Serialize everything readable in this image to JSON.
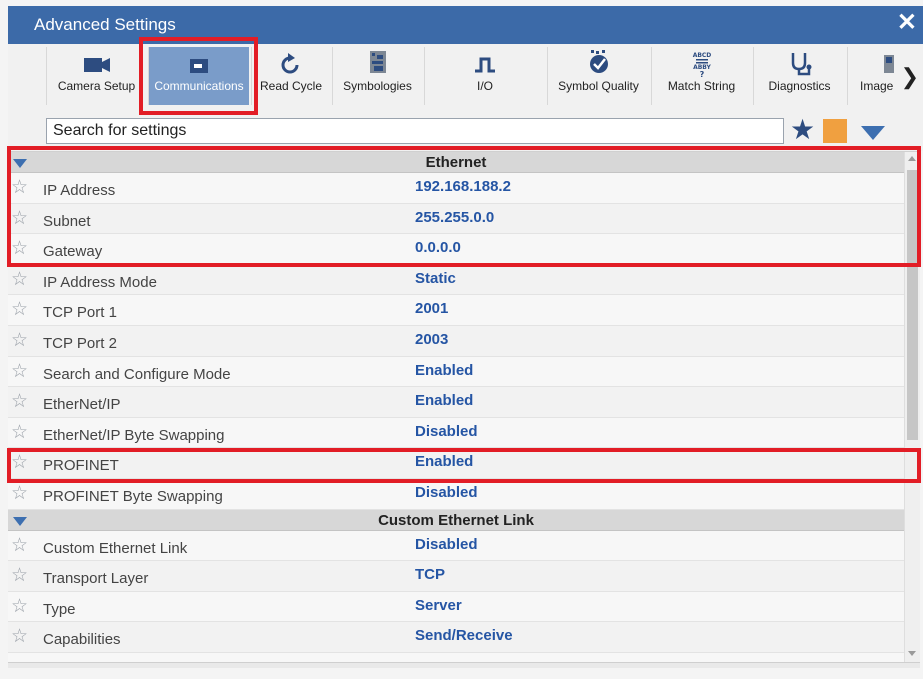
{
  "window": {
    "title": "Advanced Settings",
    "close_glyph": "✕"
  },
  "toolbar": {
    "tools": [
      {
        "label": "Camera Setup",
        "icon": "camera-icon"
      },
      {
        "label": "Communications",
        "icon": "communications-icon",
        "active": true
      },
      {
        "label": "Read Cycle",
        "icon": "read-cycle-icon"
      },
      {
        "label": "Symbologies",
        "icon": "symbologies-icon"
      },
      {
        "label": "I/O",
        "icon": "io-pulse-icon"
      },
      {
        "label": "Symbol Quality",
        "icon": "symbol-quality-icon"
      },
      {
        "label": "Match String",
        "icon": "match-string-icon"
      },
      {
        "label": "Diagnostics",
        "icon": "stethoscope-icon"
      },
      {
        "label": "Image",
        "icon": "image-icon"
      }
    ],
    "more_glyph": "❯"
  },
  "search": {
    "placeholder": "Search for settings"
  },
  "buttons": {
    "star_glyph": "★"
  },
  "sections": [
    {
      "title": "Ethernet",
      "rows": [
        {
          "name": "IP Address",
          "value": "192.168.188.2"
        },
        {
          "name": "Subnet",
          "value": "255.255.0.0"
        },
        {
          "name": "Gateway",
          "value": "0.0.0.0"
        },
        {
          "name": "IP Address Mode",
          "value": "Static"
        },
        {
          "name": "TCP Port 1",
          "value": "2001"
        },
        {
          "name": "TCP Port 2",
          "value": "2003"
        },
        {
          "name": "Search and Configure Mode",
          "value": "Enabled"
        },
        {
          "name": "EtherNet/IP",
          "value": "Enabled"
        },
        {
          "name": "EtherNet/IP Byte Swapping",
          "value": "Disabled"
        },
        {
          "name": "PROFINET",
          "value": "Enabled"
        },
        {
          "name": "PROFINET Byte Swapping",
          "value": "Disabled"
        }
      ]
    },
    {
      "title": "Custom Ethernet Link",
      "rows": [
        {
          "name": "Custom Ethernet Link",
          "value": "Disabled"
        },
        {
          "name": "Transport Layer",
          "value": "TCP"
        },
        {
          "name": "Type",
          "value": "Server"
        },
        {
          "name": "Capabilities",
          "value": "Send/Receive"
        }
      ]
    }
  ],
  "row_fav_glyph": "☆",
  "colors": {
    "title_bar": "#3c6aa8",
    "highlight": "#e21d26",
    "value_text": "#2555a4",
    "active_tab": "#7a9cc9"
  }
}
